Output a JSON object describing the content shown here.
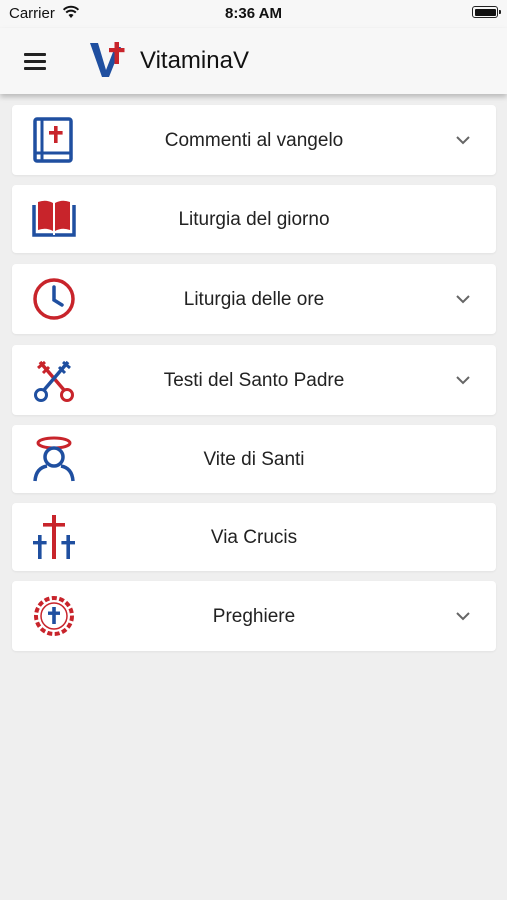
{
  "status": {
    "carrier": "Carrier",
    "time": "8:36 AM"
  },
  "app": {
    "title": "VitaminaV"
  },
  "colors": {
    "blue": "#1f4fa0",
    "red": "#c8242b",
    "background": "#efefef"
  },
  "items": [
    {
      "label": "Commenti al vangelo",
      "icon": "bible-icon",
      "expandable": true
    },
    {
      "label": "Liturgia del giorno",
      "icon": "open-book-icon",
      "expandable": false
    },
    {
      "label": "Liturgia delle ore",
      "icon": "clock-icon",
      "expandable": true
    },
    {
      "label": "Testi del Santo Padre",
      "icon": "crossed-keys-icon",
      "expandable": true
    },
    {
      "label": "Vite di Santi",
      "icon": "saint-halo-icon",
      "expandable": false
    },
    {
      "label": "Via Crucis",
      "icon": "three-crosses-icon",
      "expandable": false
    },
    {
      "label": "Preghiere",
      "icon": "rosary-icon",
      "expandable": true
    }
  ]
}
